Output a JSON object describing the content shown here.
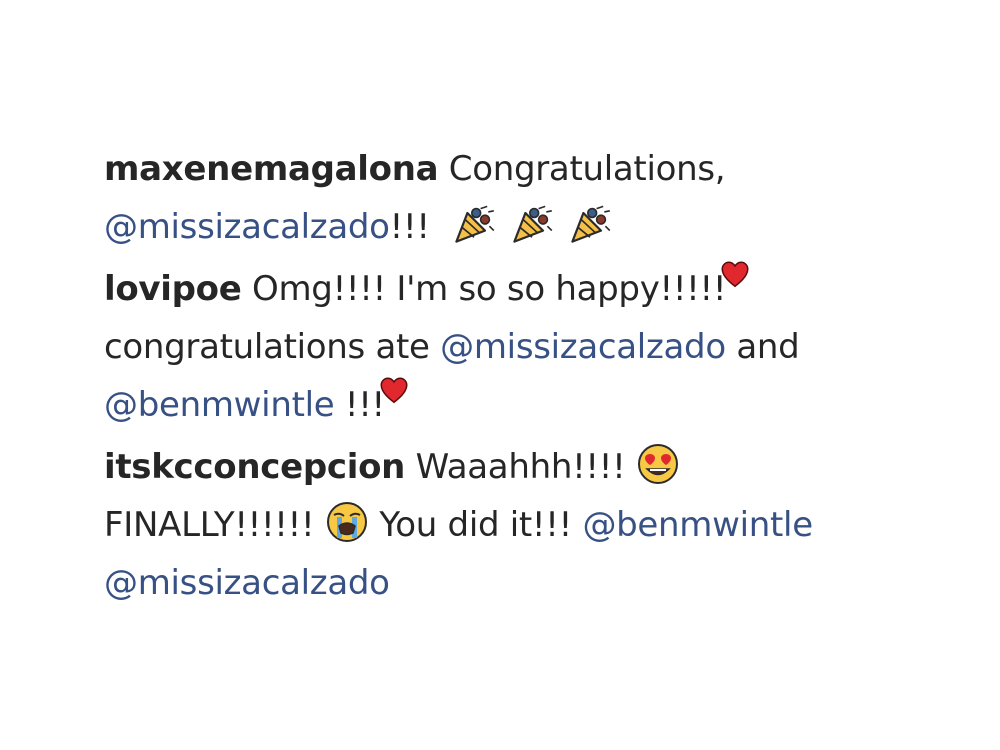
{
  "comments": [
    {
      "username": "maxenemagalona",
      "text1": "Congratulations,",
      "mention1": "@missizacalzado",
      "text2": "!!!",
      "emojis": [
        "party-popper-icon",
        "party-popper-icon",
        "party-popper-icon"
      ]
    },
    {
      "username": "lovipoe",
      "text1": "Omg!!!! I'm so so happy!!!!!",
      "emoji1": "red-heart-icon",
      "text2": "congratulations ate",
      "mention1": "@missizacalzado",
      "text3": "and",
      "mention2": "@benmwintle",
      "text4": "!!!",
      "emoji2": "red-heart-icon"
    },
    {
      "username": "itskcconcepcion",
      "text1": "Waaahhh!!!!",
      "emoji1": "heart-eyes-face-icon",
      "text2": "FINALLY!!!!!!",
      "emoji2": "loudly-crying-face-icon",
      "text3": "You did it!!!",
      "mention1": "@benmwintle",
      "mention2": "@missizacalzado"
    }
  ],
  "colors": {
    "text": "#262626",
    "mention": "#385185",
    "background": "#ffffff"
  }
}
